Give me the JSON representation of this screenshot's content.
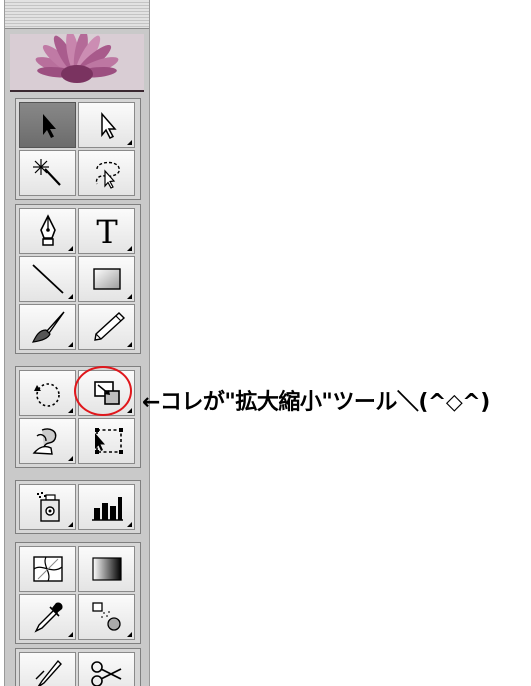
{
  "annotation": {
    "text": "←コレが\"拡大縮小\"ツール＼(^◇^)",
    "color": "#000000",
    "highlight_color": "#e0171c"
  },
  "toolbox": {
    "banner": "flower-image",
    "groups": [
      {
        "name": "selection",
        "tools": [
          {
            "icon": "selection-arrow-icon",
            "selected": true
          },
          {
            "icon": "direct-selection-arrow-icon",
            "has_flyout": true
          },
          {
            "icon": "magic-wand-icon"
          },
          {
            "icon": "lasso-icon"
          }
        ]
      },
      {
        "name": "drawing",
        "tools": [
          {
            "icon": "pen-tool-icon",
            "has_flyout": true
          },
          {
            "icon": "type-tool-icon",
            "glyph": "T",
            "has_flyout": true
          },
          {
            "icon": "line-segment-icon",
            "has_flyout": true
          },
          {
            "icon": "rectangle-icon",
            "has_flyout": true
          },
          {
            "icon": "paintbrush-icon",
            "has_flyout": true
          },
          {
            "icon": "pencil-icon",
            "has_flyout": true
          }
        ]
      },
      {
        "name": "transform",
        "tools": [
          {
            "icon": "rotate-icon",
            "has_flyout": true
          },
          {
            "icon": "scale-icon",
            "has_flyout": true,
            "highlighted": true
          },
          {
            "icon": "warp-icon",
            "has_flyout": true
          },
          {
            "icon": "free-transform-icon"
          }
        ]
      },
      {
        "name": "symbols",
        "tools": [
          {
            "icon": "symbol-sprayer-icon",
            "has_flyout": true
          },
          {
            "icon": "column-graph-icon",
            "has_flyout": true
          }
        ]
      },
      {
        "name": "paint",
        "tools": [
          {
            "icon": "mesh-icon"
          },
          {
            "icon": "gradient-icon"
          },
          {
            "icon": "eyedropper-icon",
            "has_flyout": true
          },
          {
            "icon": "blend-icon",
            "has_flyout": true
          }
        ]
      },
      {
        "name": "cut",
        "tools": [
          {
            "icon": "slice-icon"
          },
          {
            "icon": "scissors-icon"
          }
        ]
      }
    ]
  }
}
